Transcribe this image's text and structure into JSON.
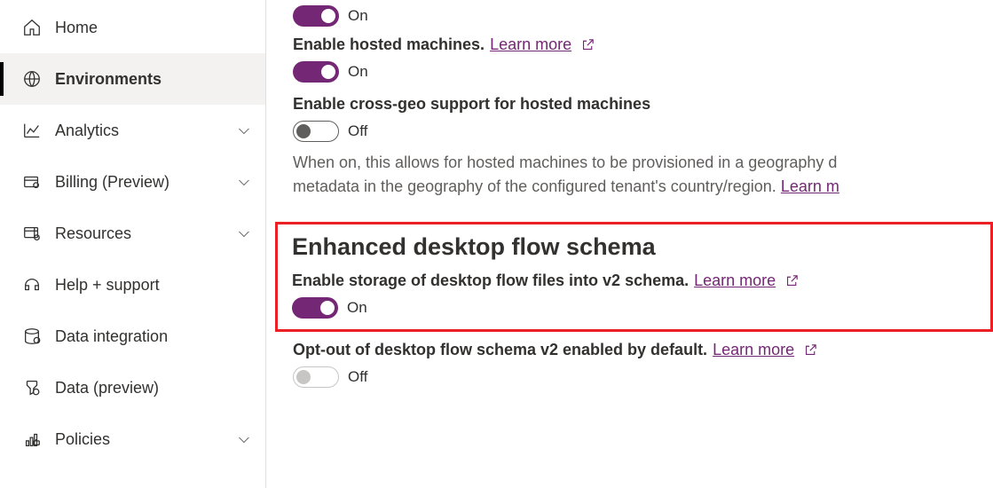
{
  "sidebar": {
    "items": [
      {
        "label": "Home"
      },
      {
        "label": "Environments"
      },
      {
        "label": "Analytics"
      },
      {
        "label": "Billing (Preview)"
      },
      {
        "label": "Resources"
      },
      {
        "label": "Help + support"
      },
      {
        "label": "Data integration"
      },
      {
        "label": "Data (preview)"
      },
      {
        "label": "Policies"
      }
    ]
  },
  "main": {
    "toggle_on_1": "On",
    "hosted_machines": {
      "title": "Enable hosted machines.",
      "learn": "Learn more",
      "state": "On"
    },
    "cross_geo": {
      "title": "Enable cross-geo support for hosted machines",
      "state": "Off",
      "desc_a": "When on, this allows for hosted machines to be provisioned in a geography d",
      "desc_b": "metadata in the geography of the configured tenant's country/region. ",
      "learn": "Learn m"
    },
    "enhanced": {
      "heading": "Enhanced desktop flow schema",
      "title": "Enable storage of desktop flow files into v2 schema.",
      "learn": "Learn more",
      "state": "On"
    },
    "optout": {
      "title": "Opt-out of desktop flow schema v2 enabled by default.",
      "learn": "Learn more",
      "state": "Off"
    }
  }
}
